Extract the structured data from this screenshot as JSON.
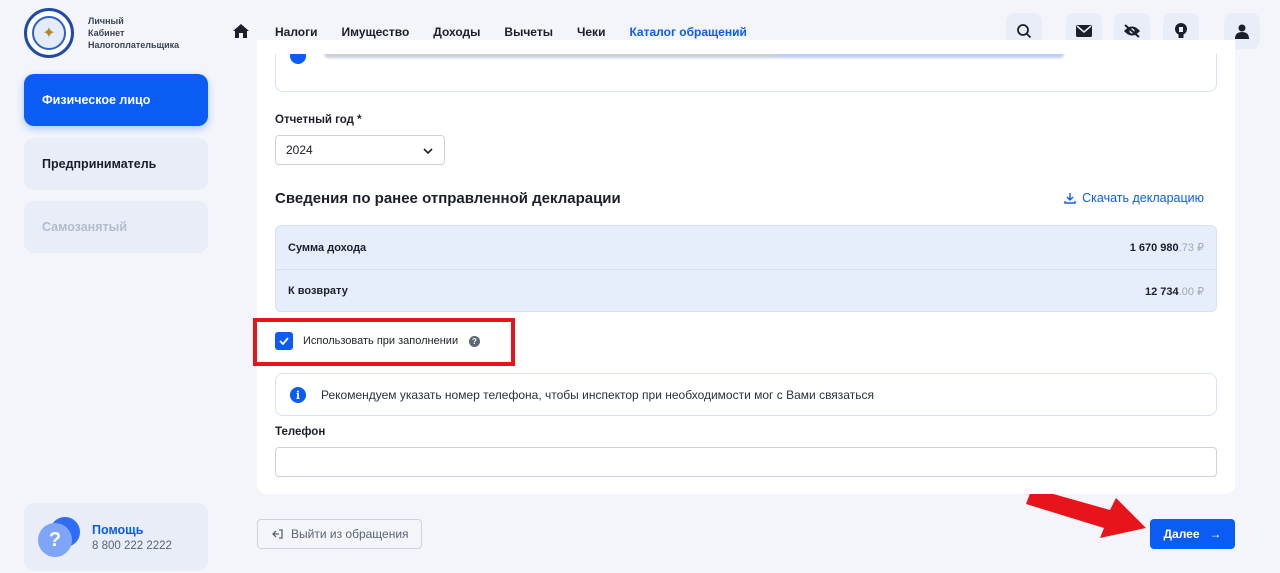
{
  "logo": {
    "line1": "Личный",
    "line2": "Кабинет",
    "line3": "Налогоплательщика"
  },
  "sidebar": {
    "items": [
      {
        "label": "Физическое лицо",
        "state": "active"
      },
      {
        "label": "Предприниматель",
        "state": "normal"
      },
      {
        "label": "Самозанятый",
        "state": "disabled"
      }
    ],
    "help": {
      "title": "Помощь",
      "phone": "8 800 222 2222"
    }
  },
  "nav": {
    "items": [
      "Налоги",
      "Имущество",
      "Доходы",
      "Вычеты",
      "Чеки",
      "Каталог обращений"
    ],
    "active": "Каталог обращений"
  },
  "toolbar": {
    "icons": [
      "search-icon",
      "mail-icon",
      "eye-off-icon",
      "lightbulb-icon",
      "user-icon"
    ]
  },
  "form": {
    "year_label": "Отчетный год *",
    "year_value": "2024",
    "section_title": "Сведения по ранее отправленной декларации",
    "download_label": "Скачать декларацию",
    "rows": [
      {
        "label": "Сумма дохода",
        "int": "1 670 980",
        "dec": ".73 ₽"
      },
      {
        "label": "К возврату",
        "int": "12 734",
        "dec": ".00 ₽"
      }
    ],
    "checkbox_label": "Использовать при заполнении",
    "checkbox_checked": true,
    "info_text": "Рекомендуем указать номер телефона, чтобы инспектор при необходимости мог с Вами связаться",
    "phone_label": "Телефон",
    "phone_value": "",
    "exit_label": "Выйти из обращения",
    "next_label": "Далее"
  },
  "colors": {
    "accent": "#0a5cf5",
    "highlight": "#e8141c"
  }
}
